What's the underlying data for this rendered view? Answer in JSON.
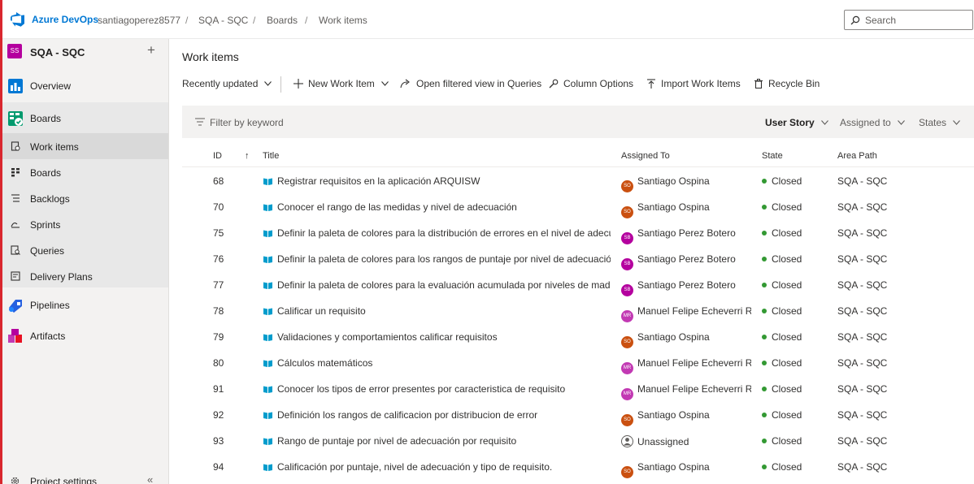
{
  "header": {
    "brand": "Azure DevOps",
    "breadcrumb": [
      "santiagoperez8577",
      "SQA - SQC",
      "Boards",
      "Work items"
    ],
    "separators": [
      "/",
      "/",
      "/"
    ],
    "search_placeholder": "Search"
  },
  "sidebar": {
    "project_initials": "SS",
    "project_name": "SQA - SQC",
    "add_label": "+",
    "overview": "Overview",
    "boards": "Boards",
    "boards_items": [
      "Work items",
      "Boards",
      "Backlogs",
      "Sprints",
      "Queries",
      "Delivery Plans"
    ],
    "selected_item": "Work items",
    "pipelines": "Pipelines",
    "artifacts": "Artifacts",
    "project_settings": "Project settings",
    "collapse": "«"
  },
  "main": {
    "title": "Work items",
    "toolbar": {
      "recently_updated": "Recently updated",
      "new_work_item": "New Work Item",
      "open_filtered": "Open filtered view in Queries",
      "column_options": "Column Options",
      "import_work_items": "Import Work Items",
      "recycle_bin": "Recycle Bin"
    },
    "filter": {
      "placeholder": "Filter by keyword",
      "type": "User Story",
      "assigned_to": "Assigned to",
      "states": "States"
    },
    "columns": {
      "id": "ID",
      "sort_arrow": "↑",
      "title": "Title",
      "assigned_to": "Assigned To",
      "state": "State",
      "area_path": "Area Path"
    },
    "rows": [
      {
        "id": "68",
        "title": "Registrar requisitos en la aplicación ARQUISW",
        "initials": "SO",
        "assigned": "Santiago Ospina",
        "state": "Closed",
        "area": "SQA - SQC",
        "color": "#ca5010"
      },
      {
        "id": "70",
        "title": "Conocer el rango de las medidas y nivel de adecuación",
        "initials": "SO",
        "assigned": "Santiago Ospina",
        "state": "Closed",
        "area": "SQA - SQC",
        "color": "#ca5010"
      },
      {
        "id": "75",
        "title": "Definir la paleta de colores para la distribución de errores en el nivel de adecuación",
        "initials": "SB",
        "assigned": "Santiago Perez Botero",
        "state": "Closed",
        "area": "SQA - SQC",
        "color": "#b4009e"
      },
      {
        "id": "76",
        "title": "Definir la paleta de colores para los rangos de puntaje por nivel de adecuación.",
        "initials": "SB",
        "assigned": "Santiago Perez Botero",
        "state": "Closed",
        "area": "SQA - SQC",
        "color": "#b4009e"
      },
      {
        "id": "77",
        "title": "Definir la paleta de colores para la evaluación acumulada por niveles de madurez, c",
        "initials": "SB",
        "assigned": "Santiago Perez Botero",
        "state": "Closed",
        "area": "SQA - SQC",
        "color": "#b4009e"
      },
      {
        "id": "78",
        "title": "Calificar un requisito",
        "initials": "MR",
        "assigned": "Manuel Felipe Echeverri R...",
        "state": "Closed",
        "area": "SQA - SQC",
        "color": "#c239b3"
      },
      {
        "id": "79",
        "title": "Validaciones y comportamientos calificar requisitos",
        "initials": "SO",
        "assigned": "Santiago Ospina",
        "state": "Closed",
        "area": "SQA - SQC",
        "color": "#ca5010"
      },
      {
        "id": "80",
        "title": "Cálculos matemáticos",
        "initials": "MR",
        "assigned": "Manuel Felipe Echeverri R...",
        "state": "Closed",
        "area": "SQA - SQC",
        "color": "#c239b3"
      },
      {
        "id": "91",
        "title": "Conocer los tipos de error presentes por caracteristica de requisito",
        "initials": "MR",
        "assigned": "Manuel Felipe Echeverri R...",
        "state": "Closed",
        "area": "SQA - SQC",
        "color": "#c239b3"
      },
      {
        "id": "92",
        "title": "Definición los rangos de calificacion por distribucion de error",
        "initials": "SO",
        "assigned": "Santiago Ospina",
        "state": "Closed",
        "area": "SQA - SQC",
        "color": "#ca5010"
      },
      {
        "id": "93",
        "title": "Rango de puntaje por nivel de adecuación por requisito",
        "initials": "",
        "assigned": "Unassigned",
        "state": "Closed",
        "area": "SQA - SQC",
        "color": "#605e5c"
      },
      {
        "id": "94",
        "title": "Calificación por puntaje, nivel de adecuación y tipo de requisito.",
        "initials": "SO",
        "assigned": "Santiago Ospina",
        "state": "Closed",
        "area": "SQA - SQC",
        "color": "#ca5010"
      }
    ]
  },
  "colors": {
    "accent": "#0078d4",
    "closed_state": "#339933",
    "edge": "#d9272e"
  }
}
